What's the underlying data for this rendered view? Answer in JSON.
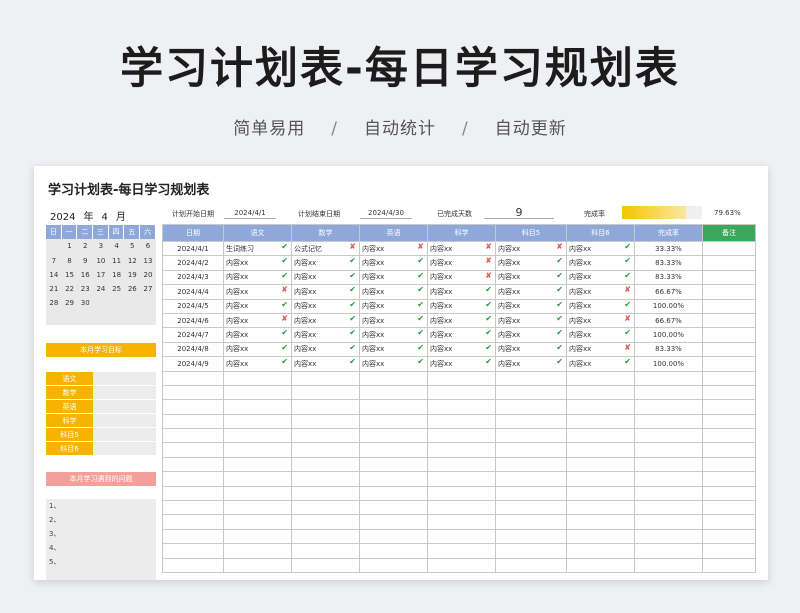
{
  "hero": {
    "title": "学习计划表-每日学习规划表",
    "tags": [
      "简单易用",
      "自动统计",
      "自动更新"
    ],
    "sep": "/"
  },
  "sheet": {
    "title": "学习计划表-每日学习规划表",
    "year": "2024",
    "year_unit": "年",
    "month": "4",
    "month_unit": "月",
    "start_label": "计划开始日期",
    "start_value": "2024/4/1",
    "end_label": "计划结束日期",
    "end_value": "2024/4/30",
    "done_days_label": "已完成天数",
    "done_days_value": "9",
    "rate_label": "完成率",
    "rate_value": "79.63%",
    "rate_fraction": 0.7963
  },
  "calendar": {
    "weekdays": [
      "日",
      "一",
      "二",
      "三",
      "四",
      "五",
      "六"
    ],
    "weeks": [
      [
        "",
        "",
        "1",
        "2",
        "3",
        "4",
        "5",
        "6"
      ],
      [
        "7",
        "8",
        "9",
        "10",
        "11",
        "12",
        "13"
      ],
      [
        "14",
        "15",
        "16",
        "17",
        "18",
        "19",
        "20"
      ],
      [
        "21",
        "22",
        "23",
        "24",
        "25",
        "26",
        "27"
      ],
      [
        "28",
        "29",
        "30",
        "",
        "",
        "",
        ""
      ],
      [
        "",
        "",
        "",
        "",
        "",
        "",
        ""
      ]
    ]
  },
  "goals": {
    "title": "本月学习目标",
    "items": [
      "语文",
      "数学",
      "英语",
      "科学",
      "科目5",
      "科目6"
    ]
  },
  "problems": {
    "title": "本月学习遇到的问题",
    "items": [
      "1、",
      "2、",
      "3、",
      "4、",
      "5、"
    ]
  },
  "table": {
    "headers": [
      "日期",
      "语文",
      "数学",
      "英语",
      "科学",
      "科目5",
      "科目6",
      "完成率",
      "备注"
    ],
    "rows": [
      {
        "date": "2024/4/1",
        "cells": [
          [
            "生词练习",
            "ok"
          ],
          [
            "公式记忆",
            "no"
          ],
          [
            "内容xx",
            "no"
          ],
          [
            "内容xx",
            "no"
          ],
          [
            "内容xx",
            "no"
          ],
          [
            "内容xx",
            "ok"
          ]
        ],
        "rate": "33.33%"
      },
      {
        "date": "2024/4/2",
        "cells": [
          [
            "内容xx",
            "ok"
          ],
          [
            "内容xx",
            "ok"
          ],
          [
            "内容xx",
            "ok"
          ],
          [
            "内容xx",
            "no"
          ],
          [
            "内容xx",
            "ok"
          ],
          [
            "内容xx",
            "ok"
          ]
        ],
        "rate": "83.33%"
      },
      {
        "date": "2024/4/3",
        "cells": [
          [
            "内容xx",
            "ok"
          ],
          [
            "内容xx",
            "ok"
          ],
          [
            "内容xx",
            "ok"
          ],
          [
            "内容xx",
            "no"
          ],
          [
            "内容xx",
            "ok"
          ],
          [
            "内容xx",
            "ok"
          ]
        ],
        "rate": "83.33%"
      },
      {
        "date": "2024/4/4",
        "cells": [
          [
            "内容xx",
            "no"
          ],
          [
            "内容xx",
            "ok"
          ],
          [
            "内容xx",
            "ok"
          ],
          [
            "内容xx",
            "ok"
          ],
          [
            "内容xx",
            "ok"
          ],
          [
            "内容xx",
            "no"
          ]
        ],
        "rate": "66.67%"
      },
      {
        "date": "2024/4/5",
        "cells": [
          [
            "内容xx",
            "ok"
          ],
          [
            "内容xx",
            "ok"
          ],
          [
            "内容xx",
            "ok"
          ],
          [
            "内容xx",
            "ok"
          ],
          [
            "内容xx",
            "ok"
          ],
          [
            "内容xx",
            "ok"
          ]
        ],
        "rate": "100.00%"
      },
      {
        "date": "2024/4/6",
        "cells": [
          [
            "内容xx",
            "no"
          ],
          [
            "内容xx",
            "ok"
          ],
          [
            "内容xx",
            "ok"
          ],
          [
            "内容xx",
            "ok"
          ],
          [
            "内容xx",
            "ok"
          ],
          [
            "内容xx",
            "no"
          ]
        ],
        "rate": "66.67%"
      },
      {
        "date": "2024/4/7",
        "cells": [
          [
            "内容xx",
            "ok"
          ],
          [
            "内容xx",
            "ok"
          ],
          [
            "内容xx",
            "ok"
          ],
          [
            "内容xx",
            "ok"
          ],
          [
            "内容xx",
            "ok"
          ],
          [
            "内容xx",
            "ok"
          ]
        ],
        "rate": "100.00%"
      },
      {
        "date": "2024/4/8",
        "cells": [
          [
            "内容xx",
            "ok"
          ],
          [
            "内容xx",
            "ok"
          ],
          [
            "内容xx",
            "ok"
          ],
          [
            "内容xx",
            "ok"
          ],
          [
            "内容xx",
            "ok"
          ],
          [
            "内容xx",
            "no"
          ]
        ],
        "rate": "83.33%"
      },
      {
        "date": "2024/4/9",
        "cells": [
          [
            "内容xx",
            "ok"
          ],
          [
            "内容xx",
            "ok"
          ],
          [
            "内容xx",
            "ok"
          ],
          [
            "内容xx",
            "ok"
          ],
          [
            "内容xx",
            "ok"
          ],
          [
            "内容xx",
            "ok"
          ]
        ],
        "rate": "100.00%"
      }
    ],
    "empty_rows": 14,
    "mark_ok": "✔",
    "mark_no": "✘",
    "colors": {
      "header": "#8fa8da",
      "note_header": "#3aa85a",
      "ok": "#2a9a3a",
      "no": "#e05555",
      "accent": "#f6b400",
      "problem_band": "#f2a09a"
    }
  }
}
